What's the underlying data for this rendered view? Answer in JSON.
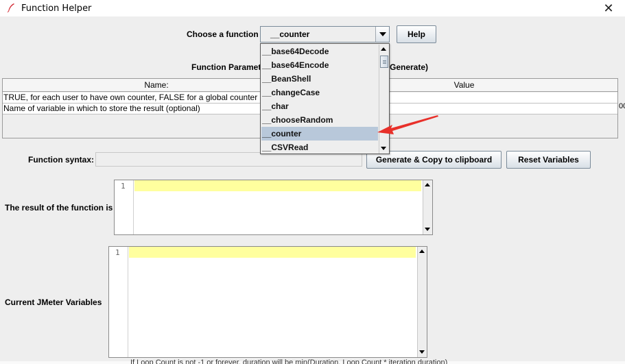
{
  "window": {
    "title": "Function Helper",
    "close_glyph": "✕",
    "icon": "feather-icon"
  },
  "chooser": {
    "label": "Choose a function",
    "selected": "__counter",
    "help_button": "Help"
  },
  "dropdown": {
    "items": [
      "__base64Decode",
      "__base64Encode",
      "__BeanShell",
      "__changeCase",
      "__char",
      "__chooseRandom",
      "__counter",
      "__CSVRead"
    ],
    "selected_index": 6
  },
  "params": {
    "label_left": "Function Paramet",
    "label_right": "Generate)",
    "columns": [
      "Name:",
      "Value"
    ],
    "rows": [
      {
        "name": "TRUE, for each user to have own counter, FALSE for a global counter",
        "value": ""
      },
      {
        "name": "Name of variable in which to store the result (optional)",
        "value": ""
      }
    ],
    "edge_glyph": "00"
  },
  "syntax": {
    "label": "Function syntax:",
    "value": "",
    "generate_button": "Generate & Copy to clipboard",
    "reset_button": "Reset Variables"
  },
  "result": {
    "label": "The result of the function is",
    "line_number": "1"
  },
  "variables": {
    "label": "Current JMeter Variables",
    "line_number": "1"
  },
  "background_text": "If Loop Count is not -1 or forever, duration will be min(Duration, Loop Count * iteration duration)",
  "colors": {
    "highlight_line": "#ffff9e",
    "selected_item": "#b8c8da",
    "arrow": "#e8302a",
    "window_bg": "#eeeeee"
  }
}
